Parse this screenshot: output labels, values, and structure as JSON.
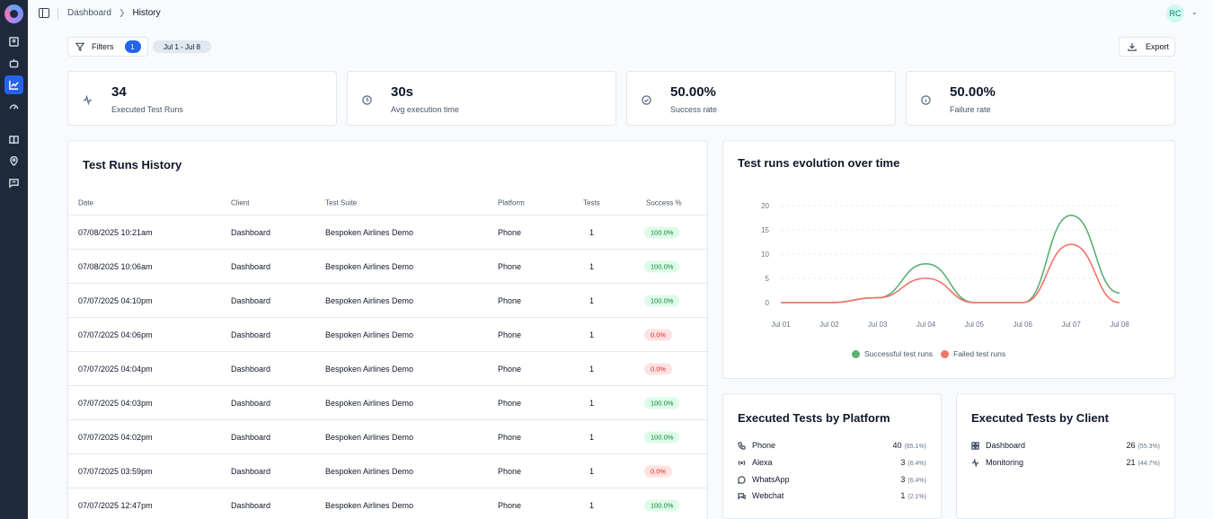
{
  "breadcrumb": {
    "root": "Dashboard",
    "current": "History"
  },
  "user": {
    "initials": "RC"
  },
  "toolbar": {
    "filters_label": "Filters",
    "filters_count": "1",
    "date_range": "Jul 1 - Jul 8",
    "export_label": "Export"
  },
  "stats": [
    {
      "value": "34",
      "label": "Executed Test Runs",
      "icon": "activity-icon"
    },
    {
      "value": "30s",
      "label": "Avg execution time",
      "icon": "clock-icon"
    },
    {
      "value": "50.00%",
      "label": "Success rate",
      "icon": "check-circle-icon"
    },
    {
      "value": "50.00%",
      "label": "Failure rate",
      "icon": "info-circle-icon"
    }
  ],
  "history": {
    "title": "Test Runs History",
    "columns": {
      "date": "Date",
      "client": "Client",
      "suite": "Test Suite",
      "platform": "Platform",
      "tests": "Tests",
      "success": "Success %"
    },
    "rows": [
      {
        "date": "07/08/2025 10:21am",
        "client": "Dashboard",
        "suite": "Bespoken Airlines Demo",
        "platform": "Phone",
        "tests": "1",
        "success": "100.0%",
        "status": "ok"
      },
      {
        "date": "07/08/2025 10:06am",
        "client": "Dashboard",
        "suite": "Bespoken Airlines Demo",
        "platform": "Phone",
        "tests": "1",
        "success": "100.0%",
        "status": "ok"
      },
      {
        "date": "07/07/2025 04:10pm",
        "client": "Dashboard",
        "suite": "Bespoken Airlines Demo",
        "platform": "Phone",
        "tests": "1",
        "success": "100.0%",
        "status": "ok"
      },
      {
        "date": "07/07/2025 04:06pm",
        "client": "Dashboard",
        "suite": "Bespoken Airlines Demo",
        "platform": "Phone",
        "tests": "1",
        "success": "0.0%",
        "status": "bad"
      },
      {
        "date": "07/07/2025 04:04pm",
        "client": "Dashboard",
        "suite": "Bespoken Airlines Demo",
        "platform": "Phone",
        "tests": "1",
        "success": "0.0%",
        "status": "bad"
      },
      {
        "date": "07/07/2025 04:03pm",
        "client": "Dashboard",
        "suite": "Bespoken Airlines Demo",
        "platform": "Phone",
        "tests": "1",
        "success": "100.0%",
        "status": "ok"
      },
      {
        "date": "07/07/2025 04:02pm",
        "client": "Dashboard",
        "suite": "Bespoken Airlines Demo",
        "platform": "Phone",
        "tests": "1",
        "success": "100.0%",
        "status": "ok"
      },
      {
        "date": "07/07/2025 03:59pm",
        "client": "Dashboard",
        "suite": "Bespoken Airlines Demo",
        "platform": "Phone",
        "tests": "1",
        "success": "0.0%",
        "status": "bad"
      },
      {
        "date": "07/07/2025 12:47pm",
        "client": "Dashboard",
        "suite": "Bespoken Airlines Demo",
        "platform": "Phone",
        "tests": "1",
        "success": "100.0%",
        "status": "ok"
      }
    ]
  },
  "evolution": {
    "title": "Test runs evolution over time",
    "colors": {
      "success": "#5cb176",
      "failed": "#f0746a"
    }
  },
  "chart_data": {
    "type": "line",
    "x": [
      "Jul 01",
      "Jul 02",
      "Jul 03",
      "Jul 04",
      "Jul 05",
      "Jul 06",
      "Jul 07",
      "Jul 08"
    ],
    "series": [
      {
        "name": "Successful test runs",
        "values": [
          0,
          0,
          1,
          8,
          0,
          0,
          18,
          2
        ]
      },
      {
        "name": "Failed test runs",
        "values": [
          0,
          0,
          1,
          5,
          0,
          0,
          12,
          0
        ]
      }
    ],
    "yticks": [
      0,
      5,
      10,
      15,
      20
    ],
    "ylim": [
      0,
      20
    ],
    "grid": true,
    "legend": "bottom"
  },
  "platforms": {
    "title": "Executed Tests by Platform",
    "items": [
      {
        "name": "Phone",
        "count": "40",
        "pct": "(85.1%)",
        "icon": "phone-icon"
      },
      {
        "name": "Alexa",
        "count": "3",
        "pct": "(6.4%)",
        "icon": "broadcast-icon"
      },
      {
        "name": "WhatsApp",
        "count": "3",
        "pct": "(6.4%)",
        "icon": "chat-bubble-icon"
      },
      {
        "name": "Webchat",
        "count": "1",
        "pct": "(2.1%)",
        "icon": "webchat-icon"
      }
    ]
  },
  "clients": {
    "title": "Executed Tests by Client",
    "items": [
      {
        "name": "Dashboard",
        "count": "26",
        "pct": "(55.3%)",
        "icon": "dashboard-icon"
      },
      {
        "name": "Monitoring",
        "count": "21",
        "pct": "(44.7%)",
        "icon": "activity-icon"
      }
    ]
  }
}
